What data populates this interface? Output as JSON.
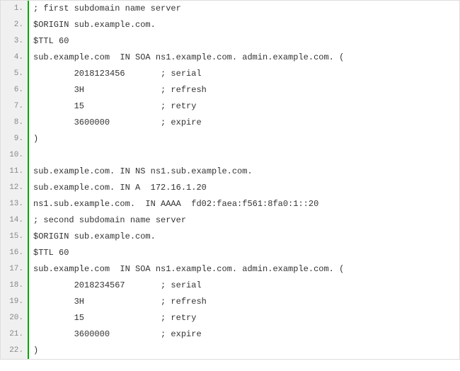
{
  "lines": [
    {
      "n": "1.",
      "t": "; first subdomain name server"
    },
    {
      "n": "2.",
      "t": "$ORIGIN sub.example.com."
    },
    {
      "n": "3.",
      "t": "$TTL 60"
    },
    {
      "n": "4.",
      "t": "sub.example.com  IN SOA ns1.example.com. admin.example.com. ("
    },
    {
      "n": "5.",
      "t": "        2018123456       ; serial"
    },
    {
      "n": "6.",
      "t": "        3H               ; refresh"
    },
    {
      "n": "7.",
      "t": "        15               ; retry"
    },
    {
      "n": "8.",
      "t": "        3600000          ; expire"
    },
    {
      "n": "9.",
      "t": ")"
    },
    {
      "n": "10.",
      "t": ""
    },
    {
      "n": "11.",
      "t": "sub.example.com. IN NS ns1.sub.example.com."
    },
    {
      "n": "12.",
      "t": "sub.example.com. IN A  172.16.1.20"
    },
    {
      "n": "13.",
      "t": "ns1.sub.example.com.  IN AAAA  fd02:faea:f561:8fa0:1::20"
    },
    {
      "n": "14.",
      "t": "; second subdomain name server"
    },
    {
      "n": "15.",
      "t": "$ORIGIN sub.example.com."
    },
    {
      "n": "16.",
      "t": "$TTL 60"
    },
    {
      "n": "17.",
      "t": "sub.example.com  IN SOA ns1.example.com. admin.example.com. ("
    },
    {
      "n": "18.",
      "t": "        2018234567       ; serial"
    },
    {
      "n": "19.",
      "t": "        3H               ; refresh"
    },
    {
      "n": "20.",
      "t": "        15               ; retry"
    },
    {
      "n": "21.",
      "t": "        3600000          ; expire"
    },
    {
      "n": "22.",
      "t": ")"
    }
  ]
}
